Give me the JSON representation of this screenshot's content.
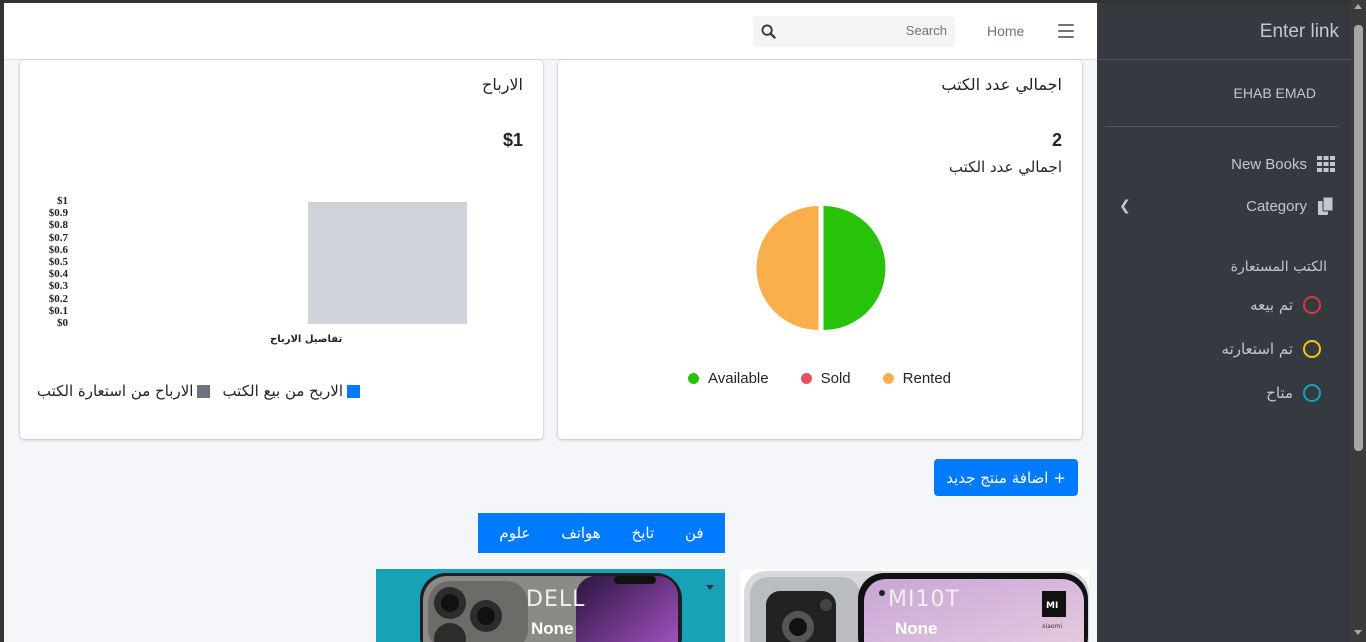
{
  "nav": {
    "search_placeholder": "Search",
    "home_label": "Home"
  },
  "profit_card": {
    "title": "الارباح",
    "total": "$1",
    "legend": [
      {
        "label": "الاربح من بيع الكتب",
        "color": "#007bff"
      },
      {
        "label": "الارباح من استعارة الكتب",
        "color": "#6c757d"
      }
    ]
  },
  "books_card": {
    "title": "اجمالي عدد الكتب",
    "total": "2",
    "subtitle": "اجمالي عدد الكتب"
  },
  "chart_data": [
    {
      "type": "bar",
      "categories": [
        "تفاصيل الارباح"
      ],
      "series": [
        {
          "values": [
            0
          ],
          "color": "#007bff"
        },
        {
          "values": [
            1
          ],
          "color": "#ced4da"
        }
      ],
      "yticks": [
        "$1",
        "$0.9",
        "$0.8",
        "$0.7",
        "$0.6",
        "$0.5",
        "$0.4",
        "$0.3",
        "$0.2",
        "$0.1",
        "$0"
      ],
      "ylim": [
        0,
        1
      ],
      "xlabel": "تفاصيل الارباح"
    },
    {
      "type": "pie",
      "categories": [
        "Available",
        "Sold",
        "Rented"
      ],
      "values": [
        1,
        0,
        1
      ],
      "colors": [
        "#28c20a",
        "#e8525f",
        "#fbaf4c"
      ]
    }
  ],
  "actions": {
    "add_product": "+ اضافة منتج جديد"
  },
  "categories": [
    "فن",
    "تايخ",
    "هواتف",
    "علوم"
  ],
  "products": [
    {
      "title": "DELL",
      "sub": "None"
    },
    {
      "title": "MI10T",
      "sub": "None",
      "brand": "xiaomi"
    }
  ],
  "sidebar": {
    "brand": "Enter link",
    "user": "EHAB EMAD",
    "items": [
      {
        "label": "New Books",
        "icon": "grid-icon"
      },
      {
        "label": "Category",
        "icon": "copy-icon"
      }
    ],
    "status_header": "الكتب المستعارة",
    "statuses": [
      {
        "label": "تم بيعه",
        "color": "#dc3545"
      },
      {
        "label": "تم استعارته",
        "color": "#ffc107"
      },
      {
        "label": "متاح",
        "color": "#17a2b8"
      }
    ]
  }
}
